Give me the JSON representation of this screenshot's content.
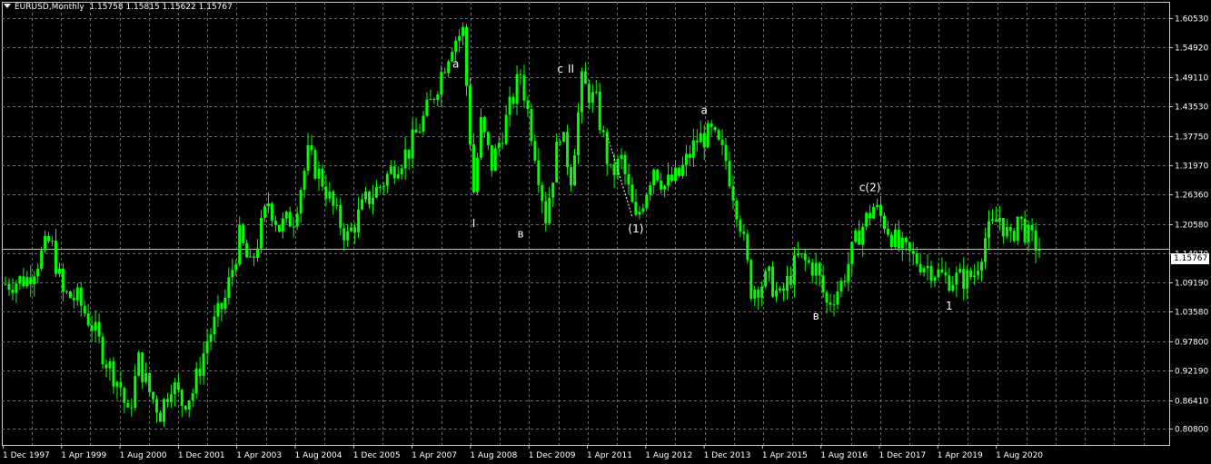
{
  "header": {
    "symbol_timeframe": "EURUSD,Monthly",
    "ohlc": "1.15758 1.15815 1.15622 1.15767"
  },
  "current_price_label": "1.15767",
  "colors": {
    "background": "#000000",
    "candles": "#00ff00",
    "grid": "#6b6b6b",
    "text": "#ffffff"
  },
  "chart_data": {
    "type": "line",
    "instrument": "EURUSD",
    "timeframe": "Monthly",
    "ylim": [
      0.777,
      1.6272
    ],
    "y_ticks": [
      "1.60530",
      "1.54920",
      "1.49110",
      "1.43530",
      "1.37750",
      "1.31970",
      "1.26360",
      "1.20580",
      "1.14970",
      "1.09190",
      "1.03580",
      "0.97800",
      "0.92190",
      "0.86410",
      "0.80800"
    ],
    "x_tick_labels": [
      "1 Dec 1997",
      "1 Apr 1999",
      "1 Aug 2000",
      "1 Dec 2001",
      "1 Apr 2003",
      "1 Aug 2004",
      "1 Dec 2005",
      "1 Apr 2007",
      "1 Aug 2008",
      "1 Dec 2009",
      "1 Apr 2011",
      "1 Aug 2012",
      "1 Dec 2013",
      "1 Apr 2015",
      "1 Aug 2016",
      "1 Dec 2017",
      "1 Apr 2019",
      "1 Aug 2020"
    ],
    "x_range": [
      "1997-12",
      "2021-11"
    ],
    "grid": true,
    "current_price": 1.15767,
    "series": [
      {
        "points": [
          [
            "1997-12",
            1.09
          ],
          [
            "1998-06",
            1.1
          ],
          [
            "1998-12",
            1.17
          ],
          [
            "1999-01",
            1.16
          ],
          [
            "1999-04",
            1.07
          ],
          [
            "1999-08",
            1.06
          ],
          [
            "1999-12",
            1.01
          ],
          [
            "2000-04",
            0.94
          ],
          [
            "2000-08",
            0.89
          ],
          [
            "2000-10",
            0.83
          ],
          [
            "2001-01",
            0.94
          ],
          [
            "2001-04",
            0.88
          ],
          [
            "2001-07",
            0.84
          ],
          [
            "2001-10",
            0.9
          ],
          [
            "2002-01",
            0.86
          ],
          [
            "2002-04",
            0.88
          ],
          [
            "2002-08",
            0.98
          ],
          [
            "2003-01",
            1.06
          ],
          [
            "2003-05",
            1.18
          ],
          [
            "2003-08",
            1.12
          ],
          [
            "2004-01",
            1.25
          ],
          [
            "2004-04",
            1.2
          ],
          [
            "2004-08",
            1.22
          ],
          [
            "2004-12",
            1.34
          ],
          [
            "2005-04",
            1.29
          ],
          [
            "2005-08",
            1.22
          ],
          [
            "2005-11",
            1.18
          ],
          [
            "2006-04",
            1.25
          ],
          [
            "2006-08",
            1.28
          ],
          [
            "2006-12",
            1.32
          ],
          [
            "2007-04",
            1.35
          ],
          [
            "2007-10",
            1.44
          ],
          [
            "2008-04",
            1.56
          ],
          [
            "2008-07",
            1.58
          ],
          [
            "2008-10",
            1.27
          ],
          [
            "2008-12",
            1.4
          ],
          [
            "2009-03",
            1.32
          ],
          [
            "2009-08",
            1.43
          ],
          [
            "2009-11",
            1.5
          ],
          [
            "2010-03",
            1.35
          ],
          [
            "2010-06",
            1.22
          ],
          [
            "2010-10",
            1.39
          ],
          [
            "2011-01",
            1.3
          ],
          [
            "2011-04",
            1.48
          ],
          [
            "2011-08",
            1.44
          ],
          [
            "2011-12",
            1.3
          ],
          [
            "2012-03",
            1.33
          ],
          [
            "2012-07",
            1.21
          ],
          [
            "2012-12",
            1.32
          ],
          [
            "2013-03",
            1.28
          ],
          [
            "2013-07",
            1.3
          ],
          [
            "2013-12",
            1.37
          ],
          [
            "2014-04",
            1.38
          ],
          [
            "2014-08",
            1.33
          ],
          [
            "2014-12",
            1.21
          ],
          [
            "2015-03",
            1.08
          ],
          [
            "2015-08",
            1.1
          ],
          [
            "2015-11",
            1.06
          ],
          [
            "2016-04",
            1.14
          ],
          [
            "2016-09",
            1.12
          ],
          [
            "2016-12",
            1.05
          ],
          [
            "2017-04",
            1.09
          ],
          [
            "2017-09",
            1.19
          ],
          [
            "2018-01",
            1.24
          ],
          [
            "2018-04",
            1.21
          ],
          [
            "2018-08",
            1.16
          ],
          [
            "2018-12",
            1.14
          ],
          [
            "2019-05",
            1.12
          ],
          [
            "2019-09",
            1.1
          ],
          [
            "2020-01",
            1.1
          ],
          [
            "2020-03",
            1.1
          ],
          [
            "2020-05",
            1.11
          ],
          [
            "2020-08",
            1.18
          ],
          [
            "2020-12",
            1.22
          ],
          [
            "2021-03",
            1.17
          ],
          [
            "2021-05",
            1.22
          ],
          [
            "2021-08",
            1.18
          ],
          [
            "2021-11",
            1.16
          ]
        ]
      }
    ],
    "annotations": [
      {
        "text": "I",
        "date": "2008-10",
        "price": 1.2
      },
      {
        "text": "a",
        "date": "2008-05",
        "price": 1.51
      },
      {
        "text": "в",
        "date": "2009-11",
        "price": 1.18
      },
      {
        "text": "c",
        "date": "2010-10",
        "price": 1.5
      },
      {
        "text": "II",
        "date": "2011-01",
        "price": 1.5
      },
      {
        "text": "(1)",
        "date": "2012-07",
        "price": 1.19
      },
      {
        "text": "a",
        "date": "2014-02",
        "price": 1.42
      },
      {
        "text": "в",
        "date": "2016-09",
        "price": 1.02
      },
      {
        "text": "c(2)",
        "date": "2017-12",
        "price": 1.27
      },
      {
        "text": "1",
        "date": "2019-10",
        "price": 1.04
      }
    ]
  }
}
